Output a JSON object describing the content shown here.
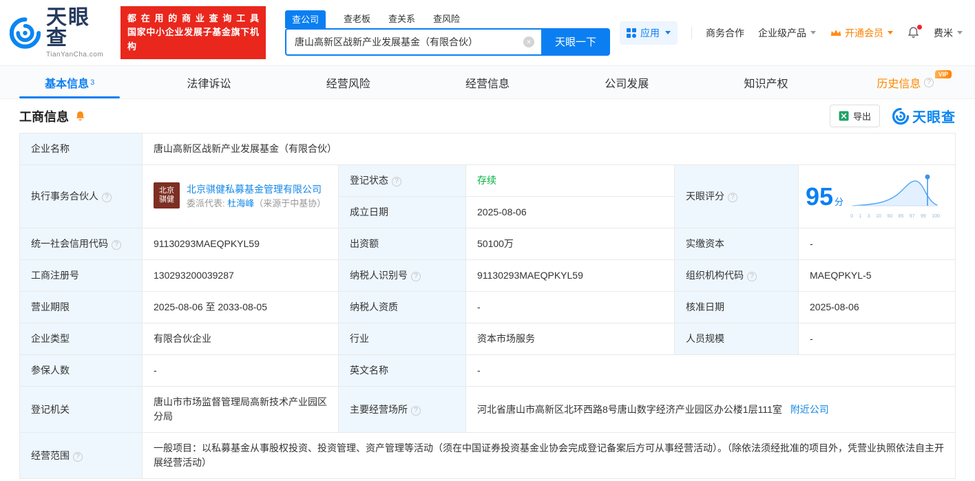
{
  "brand": {
    "logo_text": "天眼查",
    "logo_domain": "TianYanCha.com",
    "promo_line1": "都在用的商业查询工具",
    "promo_line2": "国家中小企业发展子基金旗下机构"
  },
  "search": {
    "tabs": [
      {
        "label": "查公司"
      },
      {
        "label": "查老板"
      },
      {
        "label": "查关系"
      },
      {
        "label": "查风险"
      }
    ],
    "value": "唐山高新区战新产业发展基金（有限合伙）",
    "button": "天眼一下"
  },
  "topnav": {
    "apps": "应用",
    "cooperation": "商务合作",
    "enterprise": "企业级产品",
    "member": "开通会员",
    "user": "费米"
  },
  "tabs": {
    "items": [
      {
        "label": "基本信息",
        "badge": "3"
      },
      {
        "label": "法律诉讼"
      },
      {
        "label": "经营风险"
      },
      {
        "label": "经营信息"
      },
      {
        "label": "公司发展"
      },
      {
        "label": "知识产权"
      },
      {
        "label": "历史信息",
        "vip": "VIP"
      }
    ]
  },
  "section": {
    "title": "工商信息",
    "export": "导出",
    "brand": "天眼查"
  },
  "table": {
    "company_name": {
      "label": "企业名称",
      "value": "唐山高新区战新产业发展基金（有限合伙）"
    },
    "partner": {
      "label": "执行事务合伙人",
      "logo_top": "北京",
      "logo_bottom": "骐健",
      "company": "北京骐健私募基金管理有限公司",
      "rep_label": "委派代表:",
      "rep_name": "杜海峰",
      "rep_note": "（来源于中基协）"
    },
    "reg_status": {
      "label": "登记状态",
      "value": "存续"
    },
    "establish_date": {
      "label": "成立日期",
      "value": "2025-08-06"
    },
    "score": {
      "label": "天眼评分",
      "value": "95",
      "unit": "分",
      "ticks": [
        "0",
        "1",
        "3",
        "10",
        "50",
        "85",
        "97",
        "99",
        "100"
      ]
    },
    "credit_code": {
      "label": "统一社会信用代码",
      "value": "91130293MAEQPKYL59"
    },
    "capital": {
      "label": "出资额",
      "value": "50100万"
    },
    "paid_capital": {
      "label": "实缴资本",
      "value": "-"
    },
    "reg_number": {
      "label": "工商注册号",
      "value": "130293200039287"
    },
    "taxpayer_id": {
      "label": "纳税人识别号",
      "value": "91130293MAEQPKYL59"
    },
    "org_code": {
      "label": "组织机构代码",
      "value": "MAEQPKYL-5"
    },
    "business_term": {
      "label": "营业期限",
      "value": "2025-08-06 至 2033-08-05"
    },
    "taxpayer_quality": {
      "label": "纳税人资质",
      "value": "-"
    },
    "approval_date": {
      "label": "核准日期",
      "value": "2025-08-06"
    },
    "company_type": {
      "label": "企业类型",
      "value": "有限合伙企业"
    },
    "industry": {
      "label": "行业",
      "value": "资本市场服务"
    },
    "staff_size": {
      "label": "人员规模",
      "value": "-"
    },
    "insured_count": {
      "label": "参保人数",
      "value": "-"
    },
    "english_name": {
      "label": "英文名称",
      "value": "-"
    },
    "registry": {
      "label": "登记机关",
      "value": "唐山市市场监督管理局高新技术产业园区分局"
    },
    "address": {
      "label": "主要经营场所",
      "value": "河北省唐山市高新区北环西路8号唐山数字经济产业园区办公楼1层111室",
      "link": "附近公司"
    },
    "business_scope": {
      "label": "经营范围",
      "value": "一般项目：以私募基金从事股权投资、投资管理、资产管理等活动（须在中国证券投资基金业协会完成登记备案后方可从事经营活动）。（除依法须经批准的项目外，凭营业执照依法自主开展经营活动）"
    }
  },
  "colors": {
    "brand_blue": "#0b7ff2",
    "promo_red": "#e9271d",
    "status_green": "#00b140",
    "vip_orange": "#ff8000",
    "link_blue": "#1287e8",
    "label_cell_bg": "#eef7fe"
  }
}
